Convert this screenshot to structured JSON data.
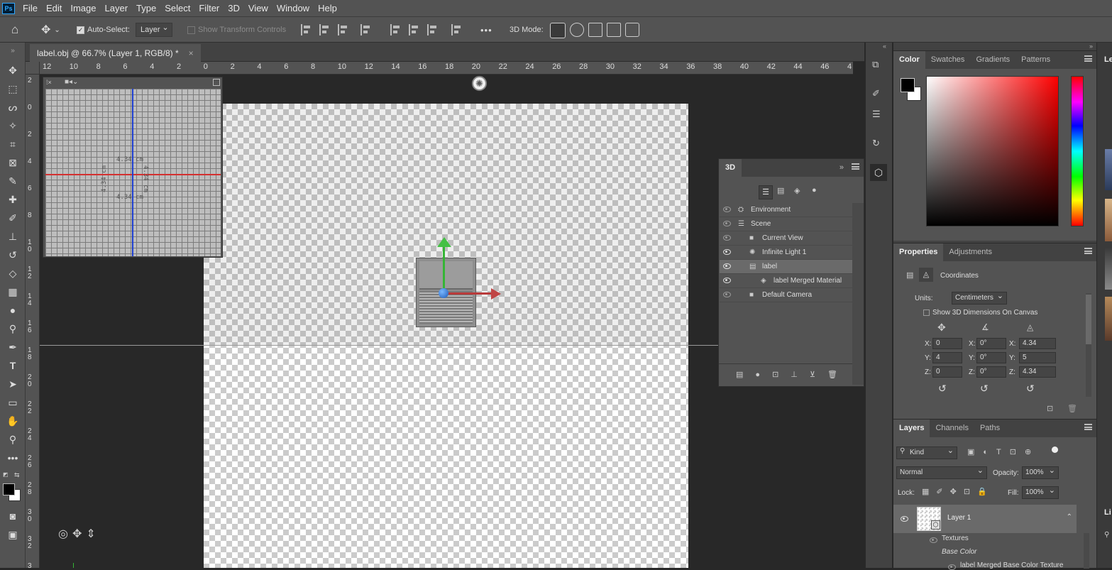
{
  "app": {
    "logo": "Ps"
  },
  "menu": [
    "File",
    "Edit",
    "Image",
    "Layer",
    "Type",
    "Select",
    "Filter",
    "3D",
    "View",
    "Window",
    "Help"
  ],
  "options": {
    "auto_select_label": "Auto-Select:",
    "auto_select_value": "Layer",
    "show_transform_controls": "Show Transform Controls",
    "more": "•••",
    "mode3d_label": "3D Mode:"
  },
  "document": {
    "tab_title": "label.obj @ 66.7% (Layer 1, RGB/8) *",
    "close": "×"
  },
  "ruler": {
    "top": [
      "12",
      "10",
      "8",
      "6",
      "4",
      "2",
      "0",
      "2",
      "4",
      "6",
      "8",
      "10",
      "12",
      "14",
      "16",
      "18",
      "20",
      "22",
      "24",
      "26",
      "28",
      "30",
      "32",
      "34",
      "36",
      "38",
      "40",
      "42",
      "44",
      "46",
      "4"
    ],
    "left": [
      "2",
      "0",
      "2",
      "4",
      "6",
      "8",
      "1\n0",
      "1\n2",
      "1\n4",
      "1\n6",
      "1\n8",
      "2\n0",
      "2\n2",
      "2\n4",
      "2\n6",
      "2\n8",
      "3\n0",
      "3\n2",
      "3"
    ]
  },
  "secondary_view": {
    "dim_top": "4.34 cm",
    "dim_bottom": "4.34 cm",
    "dim_left": "4.34 cm",
    "dim_right": "4.34 cm"
  },
  "panel3d": {
    "title": "3D",
    "items": [
      {
        "label": "Environment",
        "visible": false,
        "indent": 0
      },
      {
        "label": "Scene",
        "visible": false,
        "indent": 0
      },
      {
        "label": "Current View",
        "visible": false,
        "indent": 1
      },
      {
        "label": "Infinite Light 1",
        "visible": true,
        "indent": 1
      },
      {
        "label": "label",
        "visible": true,
        "indent": 1,
        "selected": true
      },
      {
        "label": "label Merged Material",
        "visible": true,
        "indent": 2
      },
      {
        "label": "Default Camera",
        "visible": false,
        "indent": 1
      }
    ]
  },
  "color_panel": {
    "tabs": [
      "Color",
      "Swatches",
      "Gradients",
      "Patterns"
    ],
    "foreground": "#000000",
    "background": "#ffffff",
    "hue": "#ff0000"
  },
  "properties": {
    "tabs": [
      "Properties",
      "Adjustments"
    ],
    "section": "Coordinates",
    "units_label": "Units:",
    "units_value": "Centimeters",
    "show_dims_label": "Show 3D Dimensions On Canvas",
    "position": {
      "x": "0",
      "y": "4",
      "z": "0"
    },
    "rotation": {
      "x": "0°",
      "y": "0°",
      "z": "0°"
    },
    "scale": {
      "x": "4.34",
      "y": "5",
      "z": "4.34"
    },
    "axis_labels": {
      "x": "X:",
      "y": "Y:",
      "z": "Z:"
    }
  },
  "layers": {
    "tabs": [
      "Layers",
      "Channels",
      "Paths"
    ],
    "filter_kind": "Kind",
    "blend_mode": "Normal",
    "opacity_label": "Opacity:",
    "opacity": "100%",
    "lock_label": "Lock:",
    "fill_label": "Fill:",
    "fill": "100%",
    "layer_name": "Layer 1",
    "textures_label": "Textures",
    "base_color_label": "Base Color",
    "texture_name": "label Merged Base Color Texture"
  },
  "right_edge": {
    "libraries_tab": "Le",
    "libraries_tab2": "Li"
  }
}
